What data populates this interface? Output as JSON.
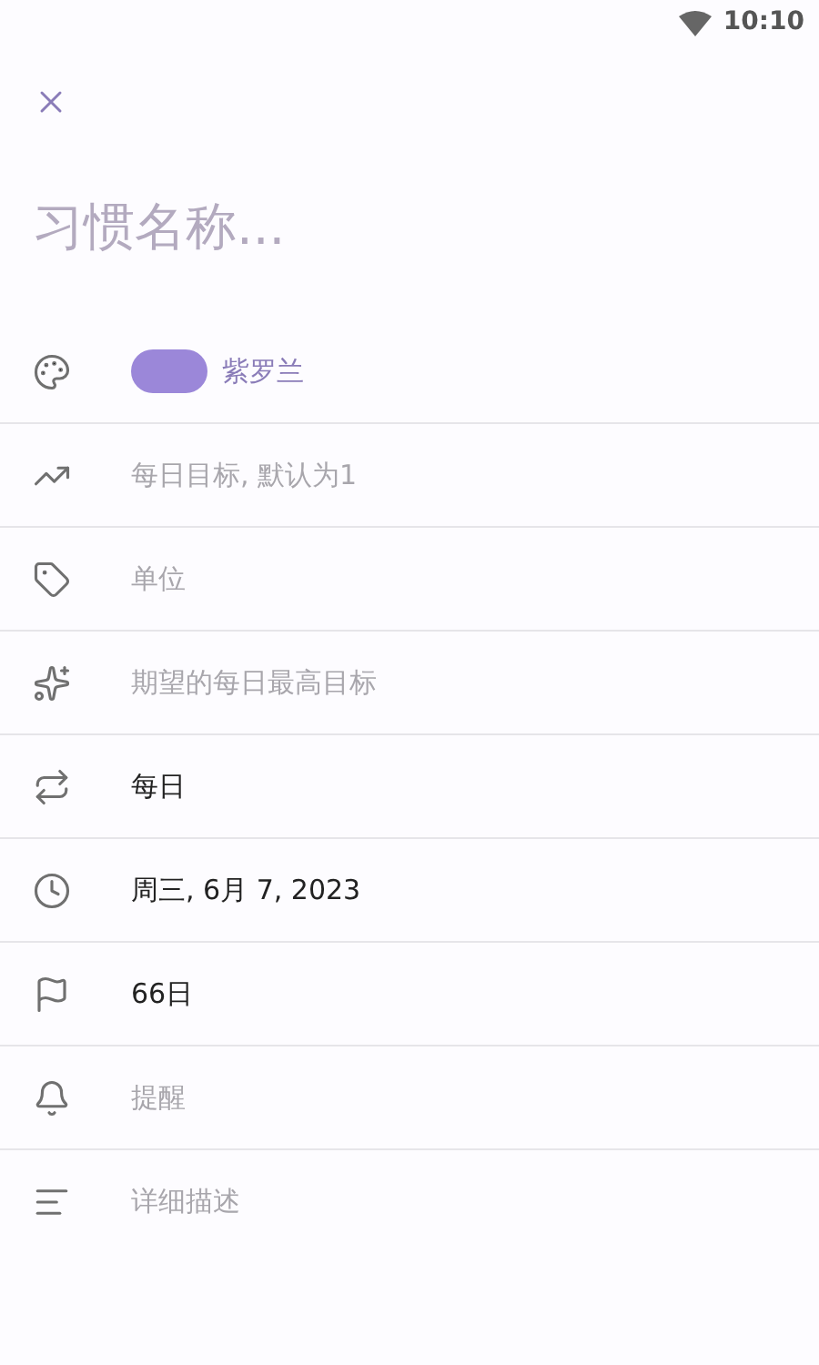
{
  "status_bar": {
    "time": "10:10"
  },
  "title_field": {
    "placeholder": "习惯名称..."
  },
  "rows": [
    {
      "kind": "color",
      "color": "#9b87d9",
      "label": "紫罗兰"
    },
    {
      "kind": "input",
      "placeholder": "每日目标, 默认为1"
    },
    {
      "kind": "input",
      "placeholder": "单位"
    },
    {
      "kind": "input",
      "placeholder": "期望的每日最高目标"
    },
    {
      "kind": "value",
      "value": "每日"
    },
    {
      "kind": "value",
      "value": "周三, 6月 7, 2023"
    },
    {
      "kind": "value",
      "value": "66日"
    },
    {
      "kind": "input",
      "placeholder": "提醒"
    },
    {
      "kind": "input",
      "placeholder": "详细描述"
    }
  ]
}
